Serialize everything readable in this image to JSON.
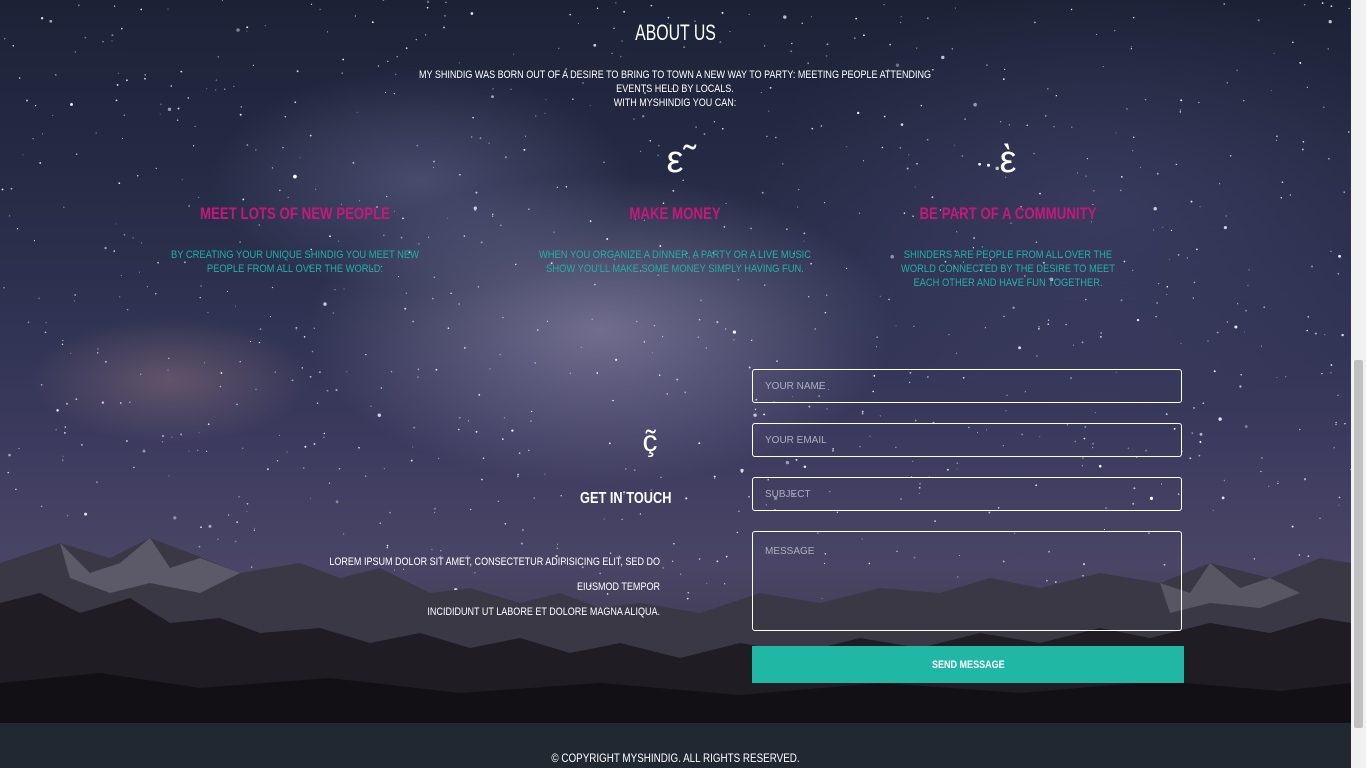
{
  "about": {
    "title": "ABOUT US",
    "text_line1": "MY SHINDIG WAS BORN OUT OF A DESIRE TO BRING TO TOWN A NEW WAY TO PARTY: MEETING PEOPLE ATTENDING EVENTS HELD BY LOCALS.",
    "text_line2": "WITH MYSHINDIG YOU CAN:"
  },
  "features": [
    {
      "icon": "dot-icon",
      "glyph": "•",
      "title": "MEET LOTS OF NEW PEOPLE",
      "description": "BY CREATING YOUR UNIQUE SHINDIG YOU MEET NEW PEOPLE FROM ALL OVER THE WORLD."
    },
    {
      "icon": "money-icon",
      "glyph": "ε̃",
      "title": "MAKE MONEY",
      "description": "WHEN YOU ORGANIZE A DINNER, A PARTY OR A LIVE MUSIC SHOW YOU'LL MAKE SOME MONEY SIMPLY HAVING FUN."
    },
    {
      "icon": "community-icon",
      "glyph": "ὲ",
      "title": "BE PART OF A COMMUNITY",
      "description": "SHINDERS ARE PEOPLE FROM ALL OVER THE WORLD CONNECTED BY THE DESIRE TO MEET EACH OTHER AND HAVE FUN TOGETHER."
    }
  ],
  "contact": {
    "icon": "chat-icon",
    "glyph": "ç̃",
    "title": "GET IN TOUCH",
    "text_line1": "LOREM IPSUM DOLOR SIT AMET, CONSECTETUR ADIPISICING ELIT, SED DO EIUSMOD TEMPOR",
    "text_line2": "INCIDIDUNT UT LABORE ET DOLORE MAGNA ALIQUA."
  },
  "form": {
    "name_placeholder": "YOUR NAME",
    "email_placeholder": "YOUR EMAIL",
    "subject_placeholder": "SUBJECT",
    "message_placeholder": "MESSAGE",
    "send_label": "SEND MESSAGE"
  },
  "footer": {
    "copyright": "© COPYRIGHT MYSHINDIG. ALL RIGHTS RESERVED."
  },
  "colors": {
    "accent_pink": "#c8177a",
    "accent_teal": "#1fb0a8",
    "button": "#20b7a5",
    "footer_bg": "#222831"
  }
}
